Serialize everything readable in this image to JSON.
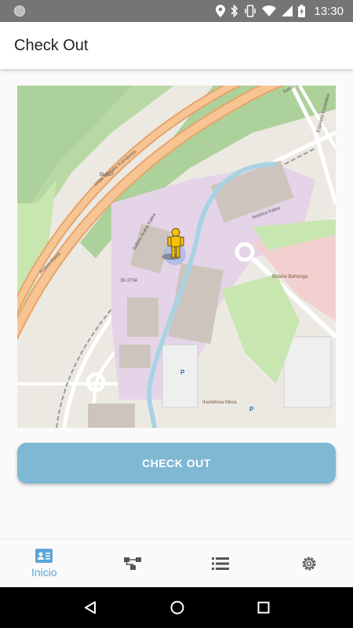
{
  "status_bar": {
    "time": "13:30",
    "icons": [
      "location-icon",
      "bluetooth-icon",
      "vibrate-icon",
      "wifi-icon",
      "cell-signal-icon",
      "battery-icon"
    ]
  },
  "app_bar": {
    "title": "Check Out"
  },
  "map": {
    "road_labels": [
      "Uribe Kostako Korridorea",
      "BI-637",
      "BI-3734",
      "Sabino Arana Kalea",
      "Arantza Kalea",
      "Andoni Etxea",
      "Santo Txiki",
      "Ezpeleta Etorbidea"
    ],
    "poi_labels": [
      "Ikastetxea Mesa",
      "Bidarte Bertenga"
    ]
  },
  "checkout_button": {
    "label": "CHECK OUT"
  },
  "bottom_nav": {
    "active_color": "#5aa6d6",
    "items": [
      {
        "icon": "id-card-icon",
        "label": "Inicio"
      },
      {
        "icon": "tree-structure-icon"
      },
      {
        "icon": "list-icon"
      },
      {
        "icon": "settings-gear-icon"
      }
    ]
  },
  "system_nav": {
    "icons": [
      "back-icon",
      "home-icon",
      "recents-icon"
    ]
  }
}
